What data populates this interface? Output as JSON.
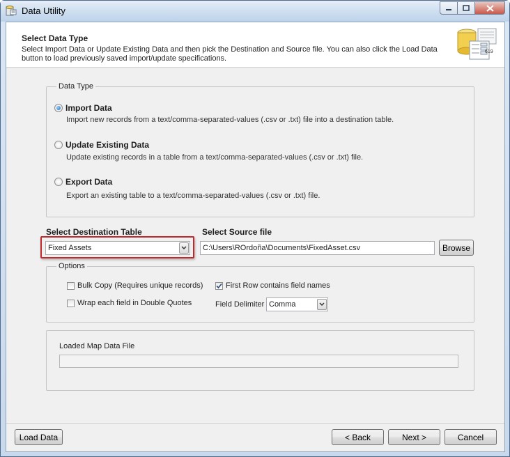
{
  "window": {
    "title": "Data Utility",
    "icon": "data-utility-icon",
    "controls": [
      "minimize-icon",
      "maximize-icon",
      "close-icon"
    ]
  },
  "header": {
    "title": "Select Data Type",
    "description": "Select Import Data or Update Existing Data and then pick the Destination and Source file.  You can also click the Load Data button to load previously saved import/update specifications.",
    "graphic_number": "619"
  },
  "data_type": {
    "legend": "Data Type",
    "options": [
      {
        "label": "Import Data",
        "description": "Import new records from a text/comma-separated-values (.csv or .txt) file into a destination table.",
        "selected": true
      },
      {
        "label": "Update Existing Data",
        "description": "Update existing records in a table from a text/comma-separated-values (.csv or .txt) file.",
        "selected": false
      },
      {
        "label": "Export Data",
        "description": "Export an existing table to a text/comma-separated-values (.csv or .txt) file.",
        "selected": false
      }
    ]
  },
  "destination": {
    "label": "Select Destination Table",
    "value": "Fixed Assets"
  },
  "source": {
    "label": "Select Source file",
    "value": "C:\\Users\\ROrdoña\\Documents\\FixedAsset.csv",
    "browse_label": "Browse"
  },
  "options": {
    "legend": "Options",
    "bulk_copy": {
      "label": "Bulk Copy (Requires unique records)",
      "checked": false
    },
    "wrap_quotes": {
      "label": "Wrap each field in Double Quotes",
      "checked": false
    },
    "first_row": {
      "label": "First Row contains field names",
      "checked": true
    },
    "field_delimiter": {
      "label": "Field Delimiter",
      "value": "Comma"
    }
  },
  "map": {
    "label": "Loaded Map Data File",
    "value": ""
  },
  "footer": {
    "load_data": "Load Data",
    "back": "< Back",
    "next": "Next >",
    "cancel": "Cancel"
  },
  "colors": {
    "highlight": "#c0282b",
    "radio_selected": "#1c63b6"
  }
}
